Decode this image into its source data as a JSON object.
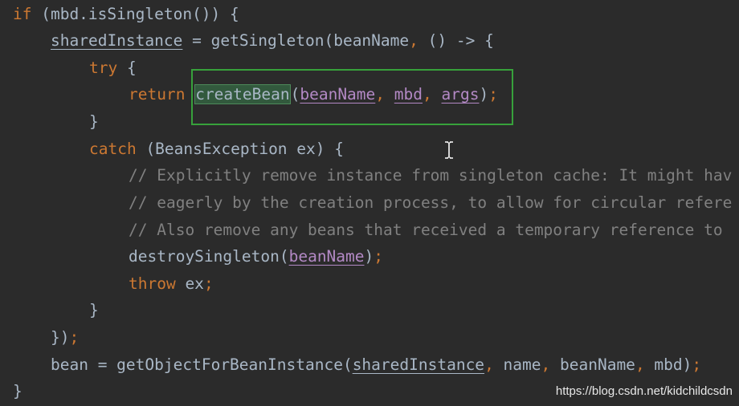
{
  "colors": {
    "background": "#2b2b2b",
    "keyword": "#cc7832",
    "identifier": "#a9b7c6",
    "parameter": "#b389c5",
    "comment": "#808080",
    "selection_border": "#37a13b",
    "word_highlight": "#32593d"
  },
  "code": {
    "l1": {
      "kw_if": "if",
      "rest": " (mbd.isSingleton()) {"
    },
    "l2": {
      "field": "sharedInstance",
      "mid": " = getSingleton(beanName",
      "comma": ",",
      "lambda": " () -> {"
    },
    "l3": {
      "kw_try": "try",
      "rest": " {"
    },
    "l4": {
      "kw_return": "return",
      "method": "createBean",
      "open": "(",
      "p1": "beanName",
      "c1": ",",
      "p2": "mbd",
      "c2": ",",
      "p3": "args",
      "close": ")",
      "semi": ";"
    },
    "l5": {
      "brace": "}"
    },
    "l6": {
      "kw_catch": "catch",
      "rest": " (BeansException ex) {"
    },
    "l7": {
      "comment": "// Explicitly remove instance from singleton cache: It might hav"
    },
    "l8": {
      "comment": "// eagerly by the creation process, to allow for circular refere"
    },
    "l9": {
      "comment": "// Also remove any beans that received a temporary reference to"
    },
    "l10": {
      "call": "destroySingleton(",
      "p1": "beanName",
      "close": ")",
      "semi": ";"
    },
    "l11": {
      "kw_throw": "throw",
      "rest": " ex",
      "semi": ";"
    },
    "l12": {
      "brace": "}"
    },
    "l13": {
      "close": "})",
      "semi": ";"
    },
    "l14": {
      "start": "bean = getObjectForBeanInstance(",
      "field": "sharedInstance",
      "c1": ",",
      "a2": " name",
      "c2": ",",
      "a3": " beanName",
      "c3": ",",
      "a4": " mbd)",
      "semi": ";"
    },
    "l15": {
      "brace": "}"
    }
  },
  "icons": {
    "cursor": "i-beam-cursor-icon"
  },
  "watermark": "https://blog.csdn.net/kidchildcsdn"
}
